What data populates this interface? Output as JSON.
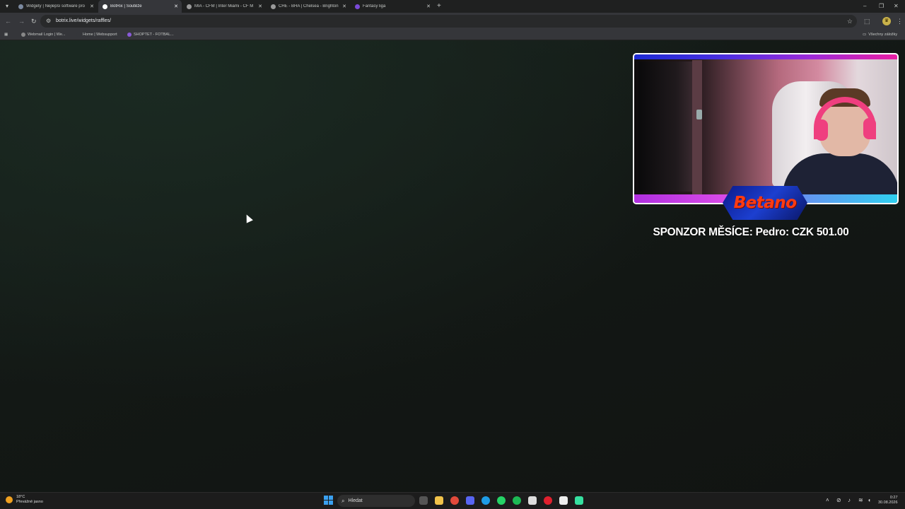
{
  "browser": {
    "tabs": [
      {
        "title": "Widgety | Nejlepší software pro",
        "favicon_color": "#7c8aa0",
        "active": false
      },
      {
        "title": "BotRix | Soutěže",
        "favicon_color": "#ffffff",
        "active": true
      },
      {
        "title": "MIA - CFM | Inter Miami - CF M",
        "favicon_color": "#9a9a9a",
        "active": false
      },
      {
        "title": "CHE - BHA | Chelsea - Brighton",
        "favicon_color": "#9a9a9a",
        "active": false
      },
      {
        "title": "Fantasy liga",
        "favicon_color": "#7a4ad8",
        "active": false
      }
    ],
    "new_tab_symbol": "+",
    "window_controls": {
      "minimize": "–",
      "restore": "❐",
      "close": "✕"
    },
    "url": "botrix.live/widgets/raffles/",
    "bookmarks": [
      {
        "label": "Webmail Login | We...",
        "icon_color": "#888888"
      },
      {
        "label": "Home | Websupport",
        "icon_color": "#35363a"
      },
      {
        "label": "SHOPTET - FOTBAL...",
        "icon_color": "#8a5ad8"
      }
    ],
    "all_bookmarks_label": "Všechny záložky"
  },
  "overlay": {
    "betano_logo": "Betano",
    "sponsor_text": "SPONZOR MĚSÍCE: Pedro: CZK 501.00"
  },
  "taskbar": {
    "weather_temp": "18°C",
    "weather_desc": "Převážně jasno",
    "search_label": "Hledat",
    "apps": [
      {
        "name": "task-view-icon",
        "color": "#555555"
      },
      {
        "name": "file-explorer-icon",
        "color": "#f2c34a"
      },
      {
        "name": "chrome-icon",
        "color": "#e24a3b"
      },
      {
        "name": "discord-icon",
        "color": "#5865f2"
      },
      {
        "name": "edge-icon",
        "color": "#1e9ce6"
      },
      {
        "name": "whatsapp-icon",
        "color": "#25d366"
      },
      {
        "name": "spotify-icon",
        "color": "#1db954"
      },
      {
        "name": "capcut-icon",
        "color": "#dddddd"
      },
      {
        "name": "app-red-icon",
        "color": "#e0202e"
      },
      {
        "name": "app-dark-icon",
        "color": "#eeeeee"
      },
      {
        "name": "app-green-icon",
        "color": "#36e0a0"
      }
    ],
    "time": "0:27",
    "date": "30.08.2026"
  }
}
